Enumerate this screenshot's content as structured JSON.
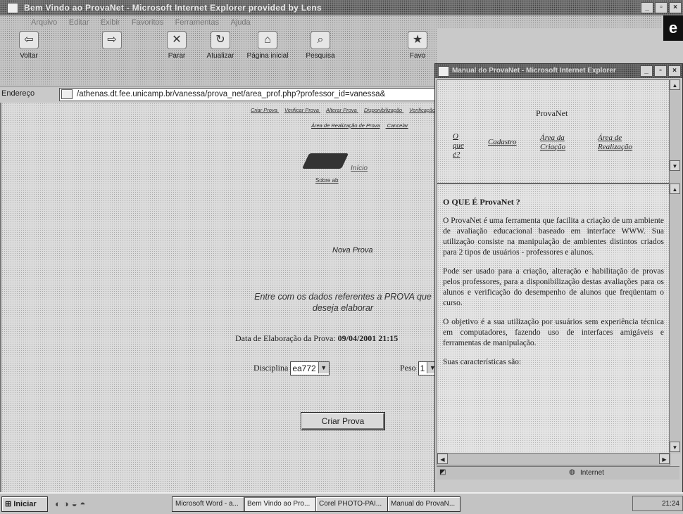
{
  "window": {
    "title": "Bem Vindo ao ProvaNet - Microsoft Internet Explorer provided by Lens",
    "menu": [
      "Arquivo",
      "Editar",
      "Exibir",
      "Favoritos",
      "Ferramentas",
      "Ajuda"
    ],
    "brand_glyph": "e"
  },
  "toolbar": {
    "buttons": [
      {
        "label": "Voltar",
        "icon": "back-arrow-icon",
        "glyph": "⇦"
      },
      {
        "label": "",
        "icon": "forward-arrow-icon",
        "glyph": "⇨"
      },
      {
        "label": "Parar",
        "icon": "stop-icon",
        "glyph": "✕"
      },
      {
        "label": "Atualizar",
        "icon": "refresh-icon",
        "glyph": "↻"
      },
      {
        "label": "Página inicial",
        "icon": "home-icon",
        "glyph": "⌂"
      },
      {
        "label": "Pesquisa",
        "icon": "search-icon",
        "glyph": "⌕"
      },
      {
        "label": "Favo",
        "icon": "favorites-icon",
        "glyph": "★"
      }
    ]
  },
  "address": {
    "label": "Endereço",
    "url": "/athenas.dt.fee.unicamp.br/vanessa/prova_net/area_prof.php?professor_id=vanessa&"
  },
  "page": {
    "nav_links": [
      "Criar Prova",
      "Verificar Prova",
      "Alterar Prova",
      "Disponibilização",
      "Verificação"
    ],
    "nav_links2": [
      "Área de Realização de Prova",
      "Cancelar"
    ],
    "inicio": "Início",
    "sobre": "Sobre ab",
    "nova_prova": "Nova Prova",
    "entre": "Entre com os dados referentes a PROVA que deseja elaborar",
    "data_label": "Data de Elaboração da Prova:",
    "data_value": "09/04/2001 21:15",
    "disciplina_label": "Disciplina",
    "disciplina_value": "ea772",
    "peso_label": "Peso",
    "peso_value": "1",
    "criar_button": "Criar Prova"
  },
  "popup": {
    "title": "Manual do ProvaNet - Microsoft Internet Explorer",
    "app_name": "ProvaNet",
    "links": [
      "O que é?",
      "Cadastro",
      "Área da Criação",
      "Área de Realização"
    ],
    "heading": "O QUE É ProvaNet ?",
    "paragraphs": [
      "O ProvaNet é uma ferramenta que facilita a criação de um ambiente de avaliação educacional baseado em interface WWW. Sua utilização consiste na manipulação de ambientes distintos criados para 2 tipos de usuários - professores e alunos.",
      "Pode ser usado para a criação, alteração e habilitação de provas pelos professores, para a disponibilização destas avaliações para os alunos e verificação do desempenho de alunos que freqüentam o curso.",
      "O objetivo é a sua utilização por usuários sem experiência técnica em computadores, fazendo uso de interfaces amigáveis e ferramentas de manipulação.",
      "Suas características são:"
    ],
    "status_zone": "Internet"
  },
  "taskbar": {
    "start": "Iniciar",
    "tasks": [
      "Microsoft Word - a...",
      "Bem Vindo ao Pro...",
      "Corel PHOTO-PAI...",
      "Manual do ProvaN..."
    ],
    "clock": "21:24"
  }
}
